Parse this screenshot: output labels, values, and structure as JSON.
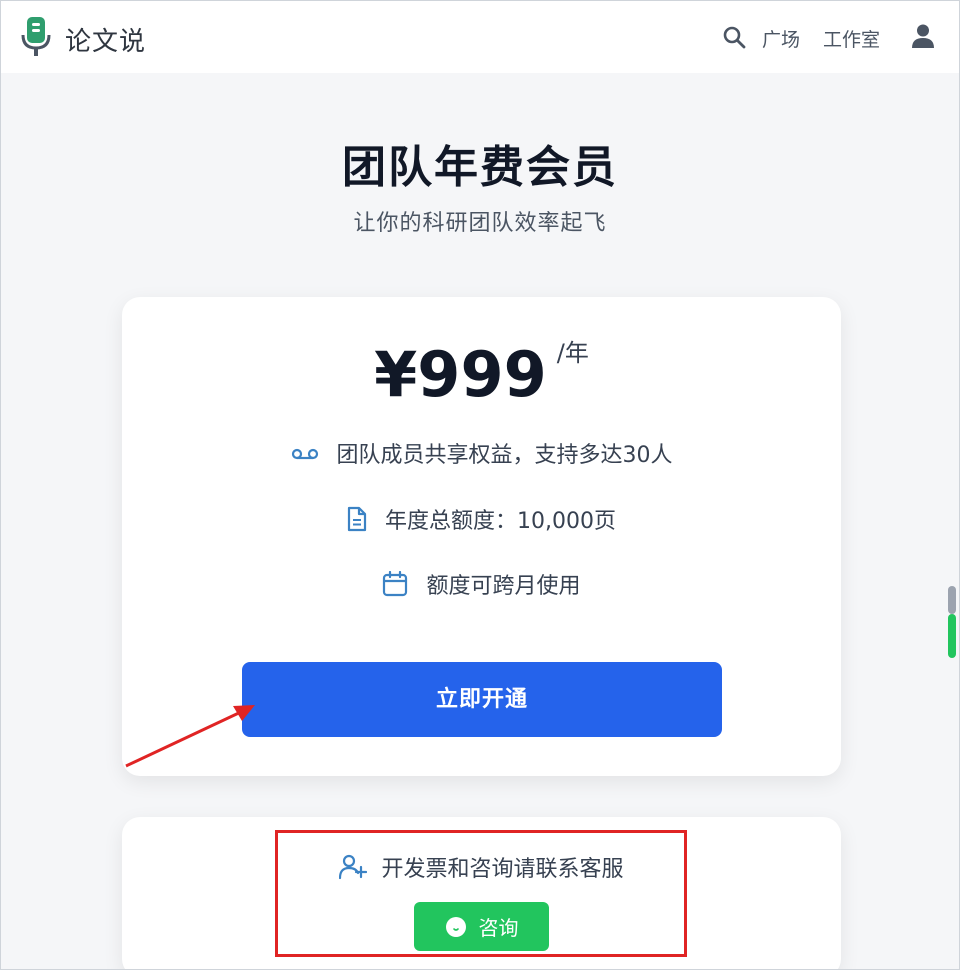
{
  "header": {
    "brand": "论文说",
    "nav": {
      "square": "广场",
      "studio": "工作室"
    },
    "icons": {
      "logo": "microphone-logo-icon",
      "search": "search-icon",
      "user": "user-icon"
    }
  },
  "hero": {
    "title": "团队年费会员",
    "subtitle": "让你的科研团队效率起飞"
  },
  "plan": {
    "price": "¥999",
    "unit": "/年",
    "features": [
      {
        "icon": "voicemail-icon",
        "text": "团队成员共享权益，支持多达30人"
      },
      {
        "icon": "document-icon",
        "text": "年度总额度：10,000页"
      },
      {
        "icon": "calendar-icon",
        "text": "额度可跨月使用"
      }
    ],
    "cta_label": "立即开通"
  },
  "contact": {
    "icon": "add-user-icon",
    "text": "开发票和咨询请联系客服",
    "button_label": "咨询",
    "button_icon": "chat-bubble-icon"
  },
  "colors": {
    "primary": "#2563eb",
    "success": "#22c55e",
    "annotation": "#e02424",
    "logo": "#2f9e6e"
  }
}
